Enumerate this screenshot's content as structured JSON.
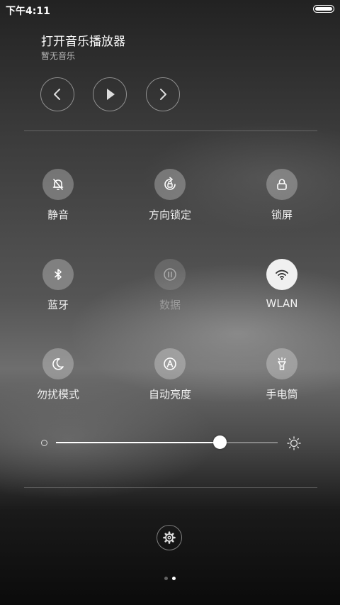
{
  "status_bar": {
    "time": "下午4:11",
    "battery_level": 1.0
  },
  "music": {
    "title": "打开音乐播放器",
    "subtitle": "暂无音乐",
    "controls": [
      {
        "name": "previous",
        "icon": "chevron-left-icon"
      },
      {
        "name": "play",
        "icon": "play-icon"
      },
      {
        "name": "next",
        "icon": "chevron-right-icon"
      }
    ]
  },
  "toggles": [
    {
      "label": "静音",
      "icon": "bell-off-icon",
      "state": "off"
    },
    {
      "label": "方向锁定",
      "icon": "rotation-lock-icon",
      "state": "off"
    },
    {
      "label": "锁屏",
      "icon": "lock-icon",
      "state": "off"
    },
    {
      "label": "蓝牙",
      "icon": "bluetooth-icon",
      "state": "off"
    },
    {
      "label": "数据",
      "icon": "data-icon",
      "state": "disabled"
    },
    {
      "label": "WLAN",
      "icon": "wifi-icon",
      "state": "on"
    },
    {
      "label": "勿扰模式",
      "icon": "moon-icon",
      "state": "off"
    },
    {
      "label": "自动亮度",
      "icon": "auto-brightness-icon",
      "state": "off"
    },
    {
      "label": "手电筒",
      "icon": "flashlight-icon",
      "state": "off"
    }
  ],
  "brightness": {
    "value": 0.74,
    "low_icon": "brightness-low-icon",
    "high_icon": "sun-icon"
  },
  "settings": {
    "icon": "gear-icon"
  },
  "pager": {
    "count": 2,
    "active": 1
  },
  "colors": {
    "active_tile": "#f0f0f0",
    "inactive_tile": "rgba(255,255,255,0.28)",
    "active_icon": "#333333"
  }
}
